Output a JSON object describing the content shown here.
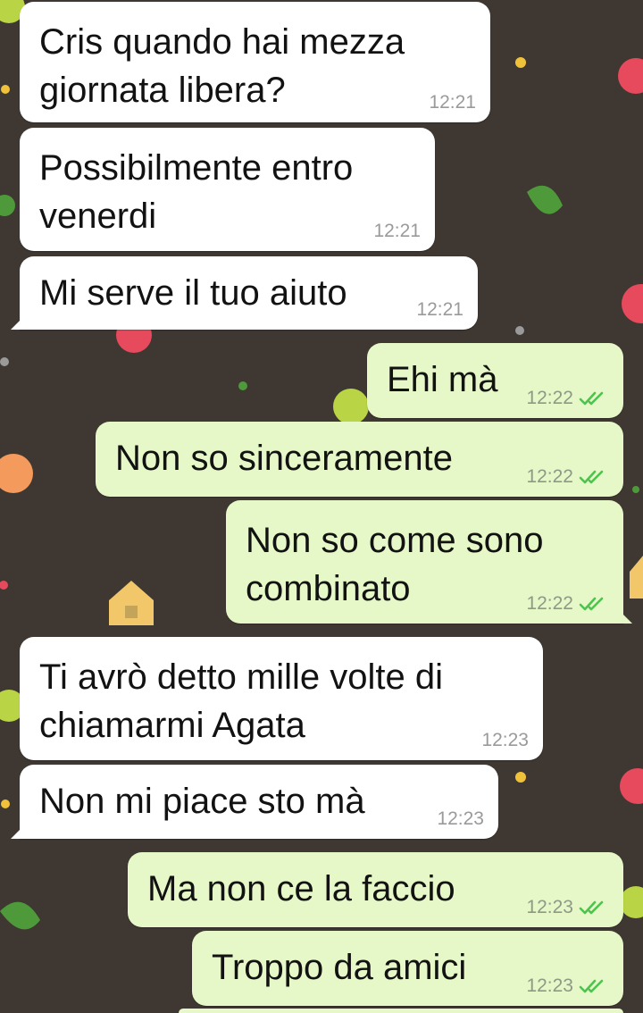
{
  "conversation": {
    "messages": [
      {
        "direction": "incoming",
        "text": "Cris quando hai mezza\ngiornata libera?",
        "time": "12:21"
      },
      {
        "direction": "incoming",
        "text": "Possibilmente entro\nvenerdi",
        "time": "12:21"
      },
      {
        "direction": "incoming",
        "text": "Mi serve il tuo aiuto",
        "time": "12:21"
      },
      {
        "direction": "outgoing",
        "text": "Ehi mà",
        "time": "12:22",
        "status": "read-double-check"
      },
      {
        "direction": "outgoing",
        "text": "Non so sinceramente",
        "time": "12:22",
        "status": "read-double-check"
      },
      {
        "direction": "outgoing",
        "text": "Non so come sono\ncombinato",
        "time": "12:22",
        "status": "read-double-check"
      },
      {
        "direction": "incoming",
        "text": "Ti avrò detto mille volte di\nchiamarmi Agata",
        "time": "12:23"
      },
      {
        "direction": "incoming",
        "text": "Non mi piace sto mà",
        "time": "12:23"
      },
      {
        "direction": "outgoing",
        "text": "Ma non ce la faccio",
        "time": "12:23",
        "status": "read-double-check"
      },
      {
        "direction": "outgoing",
        "text": "Troppo da amici",
        "time": "12:23",
        "status": "read-double-check"
      }
    ]
  },
  "colors": {
    "wallpaper": "#3f3731",
    "incoming_bubble": "#ffffff",
    "outgoing_bubble": "#e6f7c8",
    "read_ticks": "#4fc34f"
  }
}
